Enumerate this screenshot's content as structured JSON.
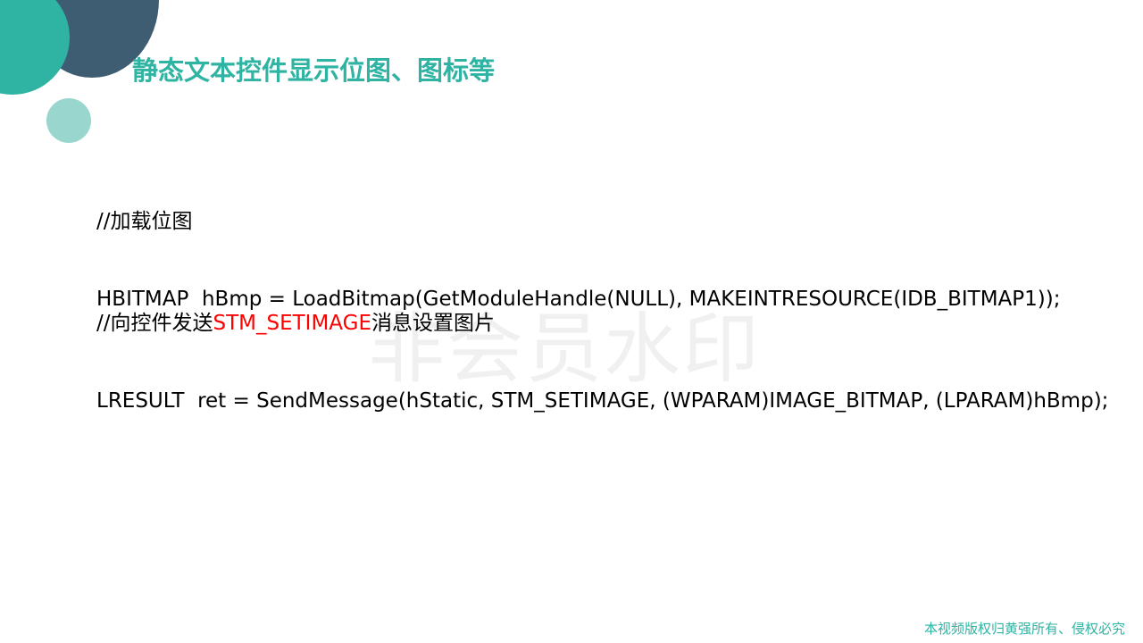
{
  "slide": {
    "title": "静态文本控件显示位图、图标等",
    "watermark": "非会员水印",
    "footer": "本视频版权归黄强所有、侵权必究",
    "colors": {
      "accent_teal": "#2fb3a3",
      "accent_dark": "#3f5d72",
      "accent_light": "#99d6cd",
      "highlight_red": "#ff0000"
    }
  },
  "code": {
    "block1": {
      "comment": "//加载位图",
      "statement": "HBITMAP  hBmp = LoadBitmap(GetModuleHandle(NULL), MAKEINTRESOURCE(IDB_BITMAP1));"
    },
    "block2": {
      "comment_prefix": "//向控件发送",
      "comment_highlight": "STM_SETIMAGE",
      "comment_suffix": "消息设置图片",
      "statement": "LRESULT  ret = SendMessage(hStatic, STM_SETIMAGE, (WPARAM)IMAGE_BITMAP, (LPARAM)hBmp);"
    }
  }
}
